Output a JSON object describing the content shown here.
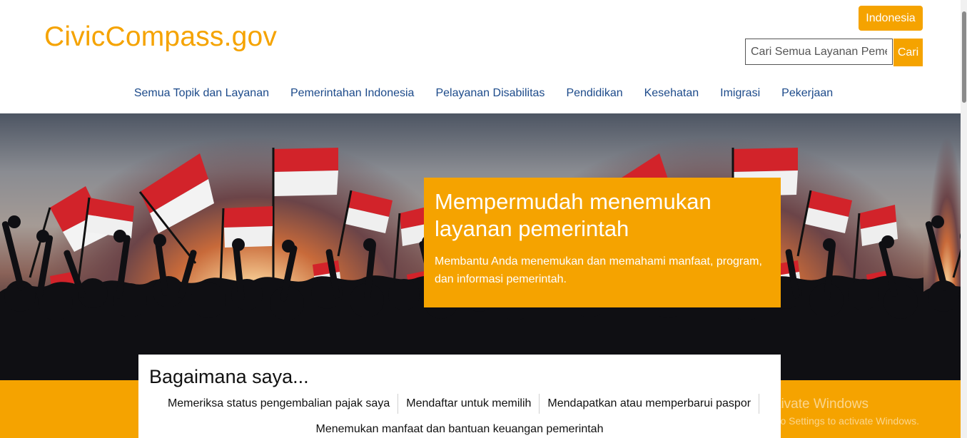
{
  "header": {
    "logo": "CivicCompass.gov",
    "language_button": "Indonesia",
    "search": {
      "placeholder": "Cari Semua Layanan Pemerintah",
      "button_label": "Cari"
    }
  },
  "nav": {
    "items": [
      {
        "label": "Semua Topik dan Layanan"
      },
      {
        "label": "Pemerintahan Indonesia"
      },
      {
        "label": "Pelayanan Disabilitas"
      },
      {
        "label": "Pendidikan"
      },
      {
        "label": "Kesehatan"
      },
      {
        "label": "Imigrasi"
      },
      {
        "label": "Pekerjaan"
      }
    ]
  },
  "hero": {
    "title": "Mempermudah menemukan layanan pemerintah",
    "description": "Membantu Anda menemukan dan memahami manfaat, program, dan informasi pemerintah.",
    "image_alt": "crowd-waving-indonesian-flags-at-sunset",
    "colors": {
      "flag_red": "#d2232a",
      "flag_white": "#f3f3f3",
      "accent": "#f5a300"
    }
  },
  "howdoi": {
    "title": "Bagaimana saya...",
    "links": [
      {
        "label": "Memeriksa status pengembalian pajak saya"
      },
      {
        "label": "Mendaftar untuk memilih"
      },
      {
        "label": "Mendapatkan atau memperbarui paspor"
      },
      {
        "label": "Menemukan manfaat dan bantuan keuangan pemerintah"
      }
    ]
  },
  "watermark": {
    "line1": "Activate Windows",
    "line2": "Go to Settings to activate Windows."
  }
}
